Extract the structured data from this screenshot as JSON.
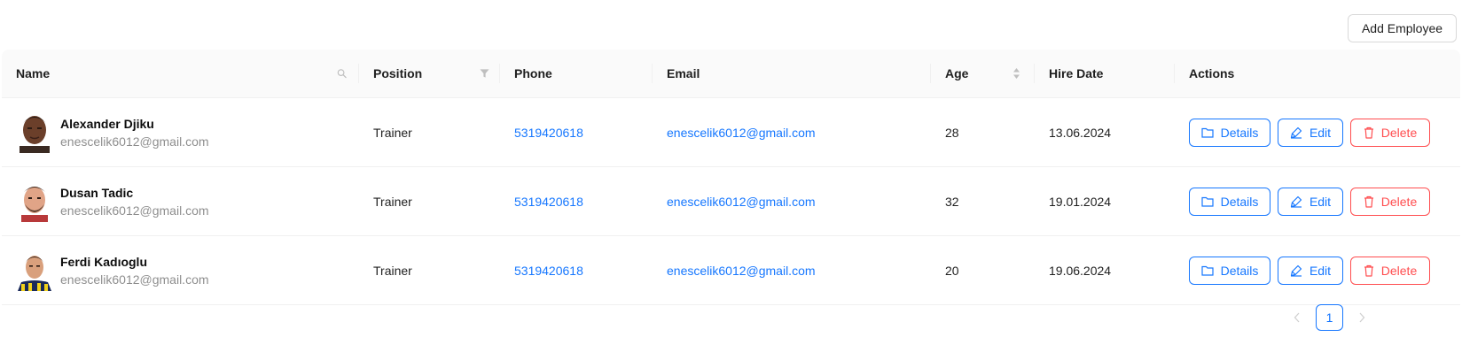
{
  "toolbar": {
    "add_label": "Add Employee"
  },
  "table": {
    "columns": {
      "name": "Name",
      "position": "Position",
      "phone": "Phone",
      "email": "Email",
      "age": "Age",
      "hire_date": "Hire Date",
      "actions": "Actions"
    },
    "rows": [
      {
        "name": "Alexander Djiku",
        "sub_email": "enescelik6012@gmail.com",
        "position": "Trainer",
        "phone": "5319420618",
        "email": "enescelik6012@gmail.com",
        "age": "28",
        "hire_date": "13.06.2024"
      },
      {
        "name": "Dusan Tadic",
        "sub_email": "enescelik6012@gmail.com",
        "position": "Trainer",
        "phone": "5319420618",
        "email": "enescelik6012@gmail.com",
        "age": "32",
        "hire_date": "19.01.2024"
      },
      {
        "name": "Ferdi Kadıoglu",
        "sub_email": "enescelik6012@gmail.com",
        "position": "Trainer",
        "phone": "5319420618",
        "email": "enescelik6012@gmail.com",
        "age": "20",
        "hire_date": "19.06.2024"
      }
    ],
    "actions": {
      "details": "Details",
      "edit": "Edit",
      "delete": "Delete"
    }
  },
  "pagination": {
    "current_page": "1"
  },
  "icons": {
    "name_header": "search-icon",
    "position_header": "filter-icon",
    "age_header": "sort-icon",
    "details": "folder-icon",
    "edit": "edit-icon",
    "delete": "delete-icon",
    "prev": "chevron-left-icon",
    "next": "chevron-right-icon"
  },
  "colors": {
    "primary": "#1677ff",
    "danger": "#ff4d4f",
    "header_bg": "#fafafa",
    "border": "#f0f0f0"
  }
}
